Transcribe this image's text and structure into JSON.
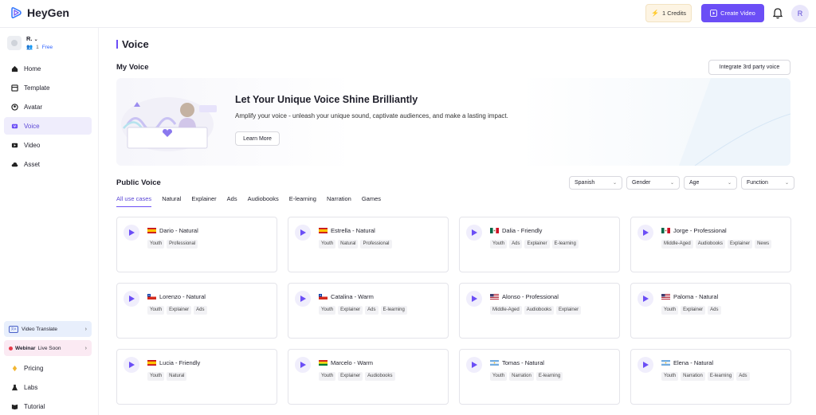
{
  "app": {
    "name": "HeyGen"
  },
  "topbar": {
    "credits_label": "1 Credits",
    "create_label": "Create Video",
    "avatar_initial": "R"
  },
  "user": {
    "name": "R.",
    "members": "1",
    "plan": "Free"
  },
  "sidebar": {
    "items": [
      {
        "label": "Home",
        "icon": "home-icon"
      },
      {
        "label": "Template",
        "icon": "template-icon"
      },
      {
        "label": "Avatar",
        "icon": "avatar-icon"
      },
      {
        "label": "Voice",
        "icon": "voice-icon",
        "active": true
      },
      {
        "label": "Video",
        "icon": "video-icon"
      },
      {
        "label": "Asset",
        "icon": "cloud-icon"
      }
    ],
    "promo_translate": "Video Translate",
    "promo_webinar_bold": "Webinar",
    "promo_webinar_rest": "Live Soon",
    "bottom_items": [
      {
        "label": "Pricing",
        "icon": "pricing-icon"
      },
      {
        "label": "Labs",
        "icon": "flask-icon"
      },
      {
        "label": "Tutorial",
        "icon": "book-icon"
      }
    ]
  },
  "page": {
    "title": "Voice",
    "my_voice_title": "My Voice",
    "integrate_label": "Integrate 3rd party voice",
    "banner_title": "Let Your Unique Voice Shine Brilliantly",
    "banner_sub": "Amplify your voice - unleash your unique sound, captivate audiences, and make a lasting impact.",
    "learn_more": "Learn More",
    "public_voice_title": "Public Voice"
  },
  "filters": [
    "Spanish",
    "Gender",
    "Age",
    "Function"
  ],
  "tabs": [
    "All use cases",
    "Natural",
    "Explainer",
    "Ads",
    "Audiobooks",
    "E-learning",
    "Narration",
    "Games"
  ],
  "voices": [
    {
      "name": "Dario - Natural",
      "flag": "es",
      "tags": [
        "Youth",
        "Professional"
      ]
    },
    {
      "name": "Estrella - Natural",
      "flag": "es",
      "tags": [
        "Youth",
        "Natural",
        "Professional"
      ]
    },
    {
      "name": "Dalia - Friendly",
      "flag": "mx",
      "tags": [
        "Youth",
        "Ads",
        "Explainer",
        "E-learning"
      ]
    },
    {
      "name": "Jorge - Professional",
      "flag": "mx",
      "tags": [
        "Middle-Aged",
        "Audiobooks",
        "Explainer",
        "News"
      ]
    },
    {
      "name": "Lorenzo - Natural",
      "flag": "cl",
      "tags": [
        "Youth",
        "Explainer",
        "Ads"
      ]
    },
    {
      "name": "Catalina - Warm",
      "flag": "cl",
      "tags": [
        "Youth",
        "Explainer",
        "Ads",
        "E-learning"
      ]
    },
    {
      "name": "Alonso - Professional",
      "flag": "us",
      "tags": [
        "Middle-Aged",
        "Audiobooks",
        "Explainer"
      ]
    },
    {
      "name": "Paloma - Natural",
      "flag": "us",
      "tags": [
        "Youth",
        "Explainer",
        "Ads"
      ]
    },
    {
      "name": "Lucia - Friendly",
      "flag": "es",
      "tags": [
        "Youth",
        "Natural"
      ]
    },
    {
      "name": "Marcelo - Warm",
      "flag": "bo",
      "tags": [
        "Youth",
        "Explainer",
        "Audiobooks"
      ]
    },
    {
      "name": "Tomas - Natural",
      "flag": "ar",
      "tags": [
        "Youth",
        "Narration",
        "E-learning"
      ]
    },
    {
      "name": "Elena - Natural",
      "flag": "ar",
      "tags": [
        "Youth",
        "Narration",
        "E-learning",
        "Ads"
      ]
    }
  ],
  "colors": {
    "accent": "#6b4ef6",
    "active_bg": "#efedfc",
    "credit_bg": "#fdf4e3"
  }
}
